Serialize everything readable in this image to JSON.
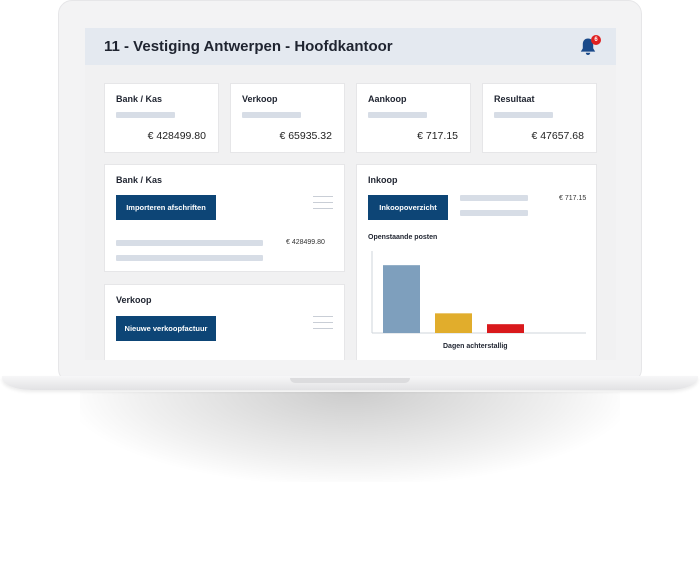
{
  "header": {
    "title": "11 - Vestiging Antwerpen - Hoofdkantoor",
    "notification_count": "6",
    "bell_color": "#1a4a8a",
    "badge_color": "#e02020"
  },
  "kpis": [
    {
      "label": "Bank / Kas",
      "value": "€ 428499.80"
    },
    {
      "label": "Verkoop",
      "value": "€ 65935.32"
    },
    {
      "label": "Aankoop",
      "value": "€ 717.15"
    },
    {
      "label": "Resultaat",
      "value": "€ 47657.68"
    }
  ],
  "bank_panel": {
    "title": "Bank / Kas",
    "button_label": "Importeren afschriften",
    "amount": "€ 428499.80"
  },
  "sales_panel": {
    "title": "Verkoop",
    "button_label": "Nieuwe verkoopfactuur"
  },
  "purchase_panel": {
    "title": "Inkoop",
    "button_label": "Inkoopoverzicht",
    "amount": "€ 717.15",
    "chart_title": "Openstaande posten",
    "chart_xlabel": "Dagen achterstallig"
  },
  "colors": {
    "primary_button": "#0d4576",
    "bar_blue": "#7e9fbd",
    "bar_yellow": "#e1ad2c",
    "bar_red": "#d9191c"
  },
  "chart_data": {
    "type": "bar",
    "title": "Openstaande posten",
    "xlabel": "Dagen achterstallig",
    "ylabel": "",
    "categories": [
      "",
      "",
      ""
    ],
    "values": [
      100,
      29,
      13
    ],
    "colors": [
      "#7e9fbd",
      "#e1ad2c",
      "#d9191c"
    ],
    "ylim": [
      0,
      115
    ]
  }
}
